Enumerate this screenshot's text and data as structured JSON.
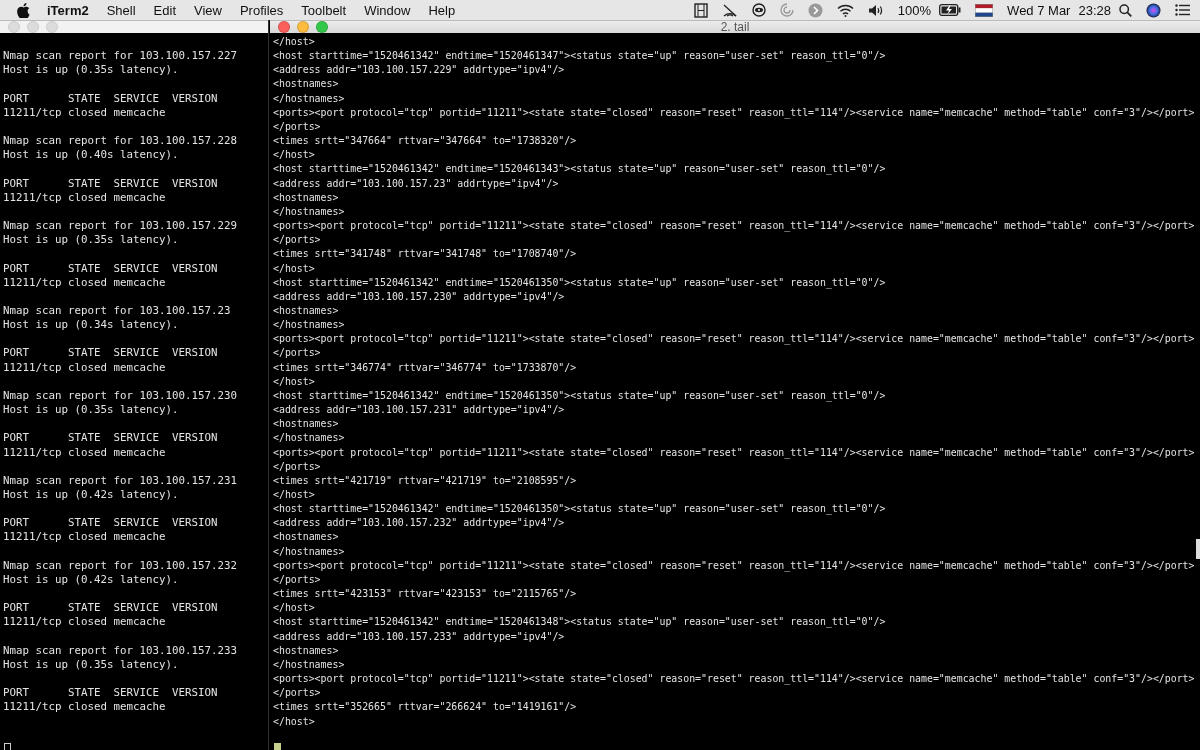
{
  "menu_bar": {
    "app_name": "iTerm2",
    "menus": [
      "Shell",
      "Edit",
      "View",
      "Profiles",
      "Toolbelt",
      "Window",
      "Help"
    ],
    "battery": "100%",
    "date": "Wed 7 Mar",
    "time": "23:28"
  },
  "left_window": {
    "active": false,
    "reports": [
      {
        "scan": "Nmap scan report for 103.100.157.227",
        "status": "Host is up (0.35s latency).",
        "header": "PORT      STATE  SERVICE  VERSION",
        "port": "11211/tcp closed memcache"
      },
      {
        "scan": "Nmap scan report for 103.100.157.228",
        "status": "Host is up (0.40s latency).",
        "header": "PORT      STATE  SERVICE  VERSION",
        "port": "11211/tcp closed memcache"
      },
      {
        "scan": "Nmap scan report for 103.100.157.229",
        "status": "Host is up (0.35s latency).",
        "header": "PORT      STATE  SERVICE  VERSION",
        "port": "11211/tcp closed memcache"
      },
      {
        "scan": "Nmap scan report for 103.100.157.23",
        "status": "Host is up (0.34s latency).",
        "header": "PORT      STATE  SERVICE  VERSION",
        "port": "11211/tcp closed memcache"
      },
      {
        "scan": "Nmap scan report for 103.100.157.230",
        "status": "Host is up (0.35s latency).",
        "header": "PORT      STATE  SERVICE  VERSION",
        "port": "11211/tcp closed memcache"
      },
      {
        "scan": "Nmap scan report for 103.100.157.231",
        "status": "Host is up (0.42s latency).",
        "header": "PORT      STATE  SERVICE  VERSION",
        "port": "11211/tcp closed memcache"
      },
      {
        "scan": "Nmap scan report for 103.100.157.232",
        "status": "Host is up (0.42s latency).",
        "header": "PORT      STATE  SERVICE  VERSION",
        "port": "11211/tcp closed memcache"
      },
      {
        "scan": "Nmap scan report for 103.100.157.233",
        "status": "Host is up (0.35s latency).",
        "header": "PORT      STATE  SERVICE  VERSION",
        "port": "11211/tcp closed memcache"
      }
    ]
  },
  "right_window": {
    "active": true,
    "title": "2. tail",
    "lines": [
      "</host>",
      "<host starttime=\"1520461342\" endtime=\"1520461347\"><status state=\"up\" reason=\"user-set\" reason_ttl=\"0\"/>",
      "<address addr=\"103.100.157.229\" addrtype=\"ipv4\"/>",
      "<hostnames>",
      "</hostnames>",
      "<ports><port protocol=\"tcp\" portid=\"11211\"><state state=\"closed\" reason=\"reset\" reason_ttl=\"114\"/><service name=\"memcache\" method=\"table\" conf=\"3\"/></port>",
      "</ports>",
      "<times srtt=\"347664\" rttvar=\"347664\" to=\"1738320\"/>",
      "</host>",
      "<host starttime=\"1520461342\" endtime=\"1520461343\"><status state=\"up\" reason=\"user-set\" reason_ttl=\"0\"/>",
      "<address addr=\"103.100.157.23\" addrtype=\"ipv4\"/>",
      "<hostnames>",
      "</hostnames>",
      "<ports><port protocol=\"tcp\" portid=\"11211\"><state state=\"closed\" reason=\"reset\" reason_ttl=\"114\"/><service name=\"memcache\" method=\"table\" conf=\"3\"/></port>",
      "</ports>",
      "<times srtt=\"341748\" rttvar=\"341748\" to=\"1708740\"/>",
      "</host>",
      "<host starttime=\"1520461342\" endtime=\"1520461350\"><status state=\"up\" reason=\"user-set\" reason_ttl=\"0\"/>",
      "<address addr=\"103.100.157.230\" addrtype=\"ipv4\"/>",
      "<hostnames>",
      "</hostnames>",
      "<ports><port protocol=\"tcp\" portid=\"11211\"><state state=\"closed\" reason=\"reset\" reason_ttl=\"114\"/><service name=\"memcache\" method=\"table\" conf=\"3\"/></port>",
      "</ports>",
      "<times srtt=\"346774\" rttvar=\"346774\" to=\"1733870\"/>",
      "</host>",
      "<host starttime=\"1520461342\" endtime=\"1520461350\"><status state=\"up\" reason=\"user-set\" reason_ttl=\"0\"/>",
      "<address addr=\"103.100.157.231\" addrtype=\"ipv4\"/>",
      "<hostnames>",
      "</hostnames>",
      "<ports><port protocol=\"tcp\" portid=\"11211\"><state state=\"closed\" reason=\"reset\" reason_ttl=\"114\"/><service name=\"memcache\" method=\"table\" conf=\"3\"/></port>",
      "</ports>",
      "<times srtt=\"421719\" rttvar=\"421719\" to=\"2108595\"/>",
      "</host>",
      "<host starttime=\"1520461342\" endtime=\"1520461350\"><status state=\"up\" reason=\"user-set\" reason_ttl=\"0\"/>",
      "<address addr=\"103.100.157.232\" addrtype=\"ipv4\"/>",
      "<hostnames>",
      "</hostnames>",
      "<ports><port protocol=\"tcp\" portid=\"11211\"><state state=\"closed\" reason=\"reset\" reason_ttl=\"114\"/><service name=\"memcache\" method=\"table\" conf=\"3\"/></port>",
      "</ports>",
      "<times srtt=\"423153\" rttvar=\"423153\" to=\"2115765\"/>",
      "</host>",
      "<host starttime=\"1520461342\" endtime=\"1520461348\"><status state=\"up\" reason=\"user-set\" reason_ttl=\"0\"/>",
      "<address addr=\"103.100.157.233\" addrtype=\"ipv4\"/>",
      "<hostnames>",
      "</hostnames>",
      "<ports><port protocol=\"tcp\" portid=\"11211\"><state state=\"closed\" reason=\"reset\" reason_ttl=\"114\"/><service name=\"memcache\" method=\"table\" conf=\"3\"/></port>",
      "</ports>",
      "<times srtt=\"352665\" rttvar=\"266624\" to=\"1419161\"/>",
      "</host>"
    ]
  }
}
